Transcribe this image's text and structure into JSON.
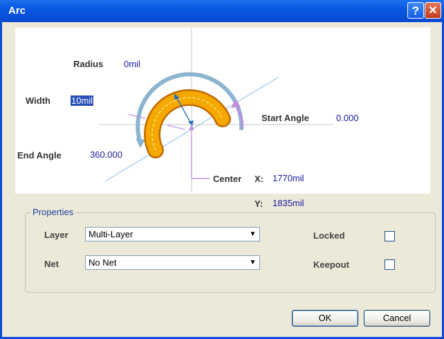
{
  "window": {
    "title": "Arc",
    "help_glyph": "?",
    "close_glyph": "✕"
  },
  "diagram": {
    "radius_label": "Radius",
    "radius_value": "0mil",
    "width_label": "Width",
    "width_value": "10mil",
    "start_angle_label": "Start Angle",
    "start_angle_value": "0.000",
    "end_angle_label": "End Angle",
    "end_angle_value": "360.000",
    "center_label": "Center",
    "x_label": "X:",
    "x_value": "1770mil",
    "y_label": "Y:",
    "y_value": "1835mil"
  },
  "properties": {
    "title": "Properties",
    "layer_label": "Layer",
    "layer_value": "Multi-Layer",
    "net_label": "Net",
    "net_value": "No Net",
    "locked_label": "Locked",
    "locked_checked": false,
    "keepout_label": "Keepout",
    "keepout_checked": false
  },
  "buttons": {
    "ok": "OK",
    "cancel": "Cancel"
  },
  "colors": {
    "title_bar": "#0a4ad8",
    "arc": "#f5a800",
    "selection": "#2a4fb8"
  }
}
